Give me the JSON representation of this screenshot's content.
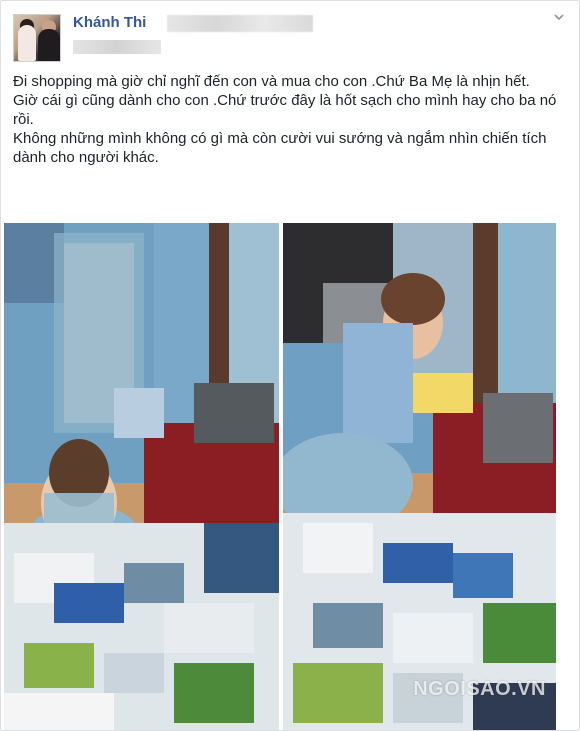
{
  "post": {
    "author_name": "Khánh Thi",
    "menu_icon": "chevron-down-icon",
    "paragraphs": [
      "Đi shopping mà giờ chỉ nghĩ đến con và mua cho con .Chứ Ba Mẹ là nhịn hết.",
      "Giờ cái gì cũng dành cho con .Chứ trước đây là hốt sạch cho mình hay cho ba nó rồi.",
      "Không những mình không có gì mà còn cười vui sướng và ngắm nhìn chiến tích dành cho người khác."
    ]
  },
  "watermark": "NGOISAO.VN",
  "colors": {
    "author_link": "#365899",
    "text": "#1d2129",
    "border": "#dddfe2"
  }
}
